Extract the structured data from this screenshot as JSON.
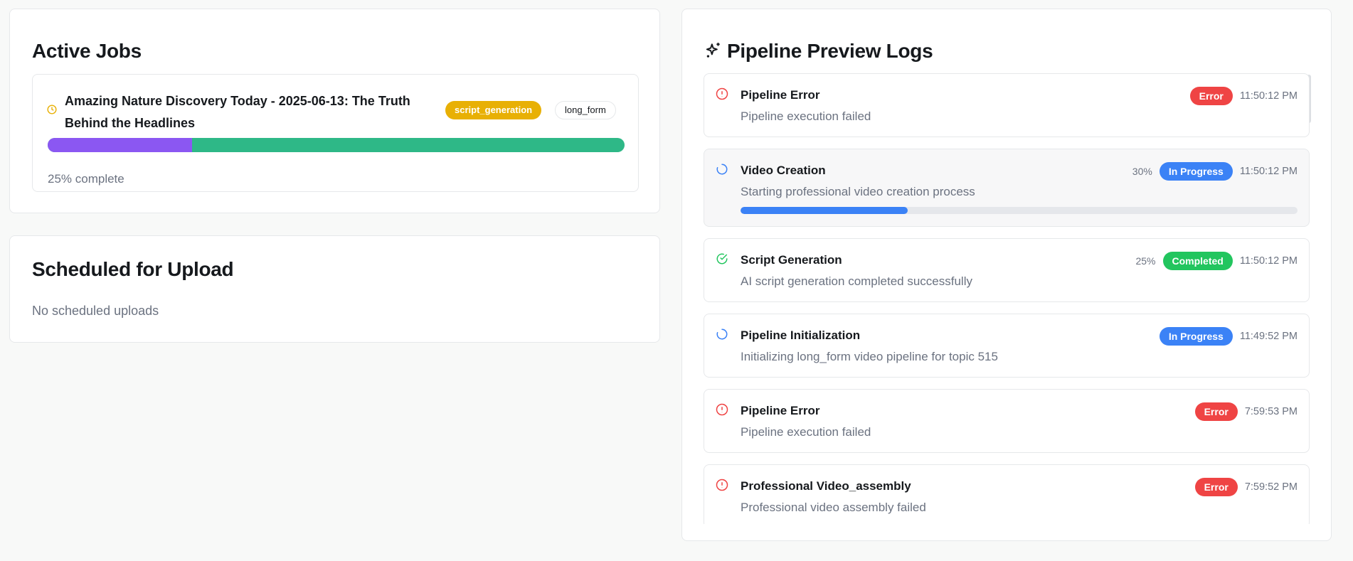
{
  "active_jobs": {
    "title": "Active Jobs",
    "jobs": [
      {
        "title": "Amazing Nature Discovery Today - 2025-06-13: The Truth Behind the Headlines",
        "stage": "script_generation",
        "type": "long_form",
        "progress": 25,
        "progress_label": "25% complete"
      }
    ]
  },
  "scheduled": {
    "title": "Scheduled for Upload",
    "empty": "No scheduled uploads"
  },
  "logs": {
    "title": "Pipeline Preview Logs",
    "items": [
      {
        "icon": "alert-circle-icon",
        "title": "Pipeline Error",
        "desc": "Pipeline execution failed",
        "status": "Error",
        "time": "11:50:12 PM",
        "pct": null
      },
      {
        "icon": "spinner-icon",
        "title": "Video Creation",
        "desc": "Starting professional video creation process",
        "status": "In Progress",
        "time": "11:50:12 PM",
        "pct": "30%",
        "progress": 30
      },
      {
        "icon": "check-circle-icon",
        "title": "Script Generation",
        "desc": "AI script generation completed successfully",
        "status": "Completed",
        "time": "11:50:12 PM",
        "pct": "25%"
      },
      {
        "icon": "spinner-icon",
        "title": "Pipeline Initialization",
        "desc": "Initializing long_form video pipeline for topic 515",
        "status": "In Progress",
        "time": "11:49:52 PM",
        "pct": null
      },
      {
        "icon": "alert-circle-icon",
        "title": "Pipeline Error",
        "desc": "Pipeline execution failed",
        "status": "Error",
        "time": "7:59:53 PM",
        "pct": null
      },
      {
        "icon": "alert-circle-icon",
        "title": "Professional Video_assembly",
        "desc": "Professional video assembly failed",
        "status": "Error",
        "time": "7:59:52 PM",
        "pct": null
      }
    ]
  },
  "colors": {
    "error": "#ef4444",
    "progress": "#3b82f6",
    "completed": "#22c55e",
    "stage": "#e8b005",
    "job_fill": "#8b57f2",
    "job_track": "#2eb887"
  }
}
